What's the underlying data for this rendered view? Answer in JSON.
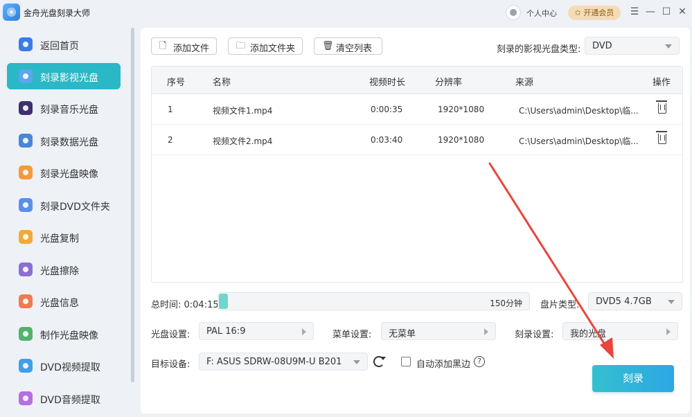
{
  "titlebar": {
    "app_title": "金舟光盘刻录大师",
    "user_center": "个人中心",
    "vip": "✩ 开通会员",
    "menu_glyph": "☰",
    "minimize_glyph": "—",
    "maximize_glyph": "☐",
    "close_glyph": "✕"
  },
  "sidebar": {
    "items": [
      {
        "label": "返回首页",
        "icon": "home-icon",
        "color": "#3b7be6"
      },
      {
        "label": "刻录影视光盘",
        "icon": "video-disc-icon",
        "color": "#5aa7ee",
        "active": true
      },
      {
        "label": "刻录音乐光盘",
        "icon": "music-disc-icon",
        "color": "#3e2f6e"
      },
      {
        "label": "刻录数据光盘",
        "icon": "data-disc-icon",
        "color": "#4a86d6"
      },
      {
        "label": "刻录光盘映像",
        "icon": "disc-image-icon",
        "color": "#f39a3c"
      },
      {
        "label": "刻录DVD文件夹",
        "icon": "dvd-folder-icon",
        "color": "#5c8fe8"
      },
      {
        "label": "光盘复制",
        "icon": "disc-copy-icon",
        "color": "#f3a93a"
      },
      {
        "label": "光盘擦除",
        "icon": "disc-erase-icon",
        "color": "#8b6fd6"
      },
      {
        "label": "光盘信息",
        "icon": "disc-info-icon",
        "color": "#f07a52"
      },
      {
        "label": "制作光盘映像",
        "icon": "make-image-icon",
        "color": "#52b36d"
      },
      {
        "label": "DVD视频提取",
        "icon": "dvd-video-extract-icon",
        "color": "#3f9fe8"
      },
      {
        "label": "DVD音频提取",
        "icon": "dvd-audio-extract-icon",
        "color": "#b46fe0"
      }
    ]
  },
  "toolbar": {
    "add_file": "添加文件",
    "add_folder": "添加文件夹",
    "clear_list": "清空列表",
    "disc_type_label": "刻录的影视光盘类型:",
    "disc_type_value": "DVD"
  },
  "table": {
    "headers": [
      "序号",
      "名称",
      "视频时长",
      "分辨率",
      "来源",
      "操作"
    ],
    "rows": [
      [
        "1",
        "视频文件1.mp4",
        "0:00:35",
        "1920*1080",
        "C:\\Users\\admin\\Desktop\\临..."
      ],
      [
        "2",
        "视频文件2.mp4",
        "0:03:40",
        "1920*1080",
        "C:\\Users\\admin\\Desktop\\临..."
      ]
    ]
  },
  "footer": {
    "total_time": "总时间: 0:04:15",
    "capacity_label": "150分钟",
    "progress_fraction": 0.028,
    "media_type_label": "盘片类型:",
    "media_type_value": "DVD5 4.7GB",
    "disc_setting_label": "光盘设置:",
    "disc_setting_value": "PAL 16:9",
    "menu_setting_label": "菜单设置:",
    "menu_setting_value": "无菜单",
    "burn_setting_label": "刻录设置:",
    "burn_setting_value": "我的光盘",
    "target_device_label": "目标设备:",
    "target_device_value": "F: ASUS SDRW-08U9M-U B201",
    "auto_black_label": "自动添加黑边",
    "burn_button": "刻录"
  }
}
